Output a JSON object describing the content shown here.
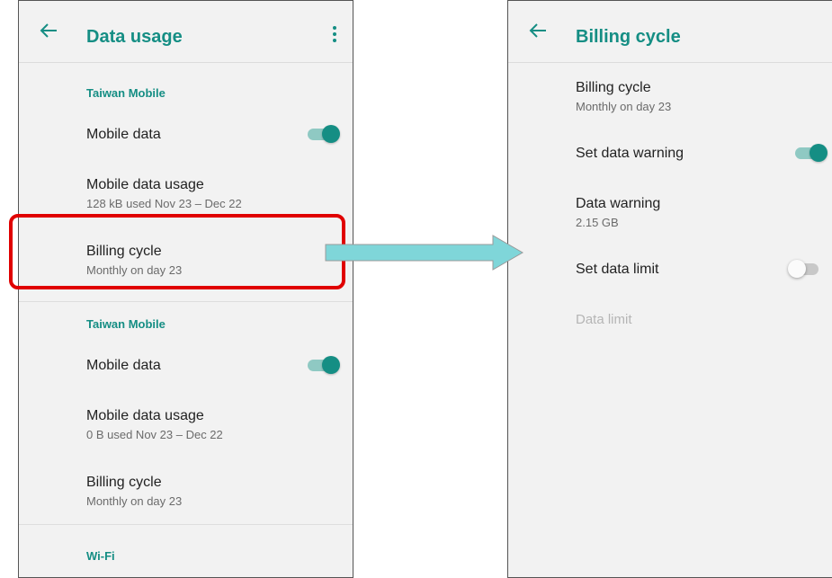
{
  "left": {
    "title": "Data usage",
    "sections": [
      {
        "header": "Taiwan Mobile",
        "mobile_data_label": "Mobile data",
        "mobile_data_on": true,
        "usage_title": "Mobile data usage",
        "usage_summary": "128 kB used Nov 23 – Dec 22",
        "billing_title": "Billing cycle",
        "billing_summary": "Monthly on day 23"
      },
      {
        "header": "Taiwan Mobile",
        "mobile_data_label": "Mobile data",
        "mobile_data_on": true,
        "usage_title": "Mobile data usage",
        "usage_summary": "0 B used Nov 23 – Dec 22",
        "billing_title": "Billing cycle",
        "billing_summary": "Monthly on day 23"
      }
    ],
    "wifi_header": "Wi-Fi"
  },
  "right": {
    "title": "Billing cycle",
    "billing_cycle_title": "Billing cycle",
    "billing_cycle_summary": "Monthly on day 23",
    "set_data_warning_label": "Set data warning",
    "set_data_warning_on": true,
    "data_warning_title": "Data warning",
    "data_warning_value": "2.15 GB",
    "set_data_limit_label": "Set data limit",
    "set_data_limit_on": false,
    "data_limit_label": "Data limit"
  },
  "icons": {
    "back": "arrow-back-icon",
    "overflow": "more-vert-icon"
  },
  "colors": {
    "accent": "#158e84",
    "accent_track": "#8fc9c3",
    "highlight": "#e00000",
    "callout_arrow": "#7fd6d9",
    "screen_background": "#f2f2f2"
  }
}
